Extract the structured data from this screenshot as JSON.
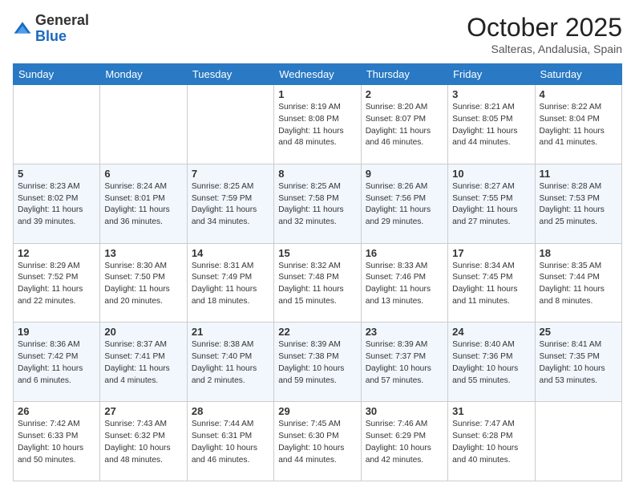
{
  "logo": {
    "general": "General",
    "blue": "Blue"
  },
  "header": {
    "month": "October 2025",
    "location": "Salteras, Andalusia, Spain"
  },
  "days_of_week": [
    "Sunday",
    "Monday",
    "Tuesday",
    "Wednesday",
    "Thursday",
    "Friday",
    "Saturday"
  ],
  "weeks": [
    [
      {
        "day": "",
        "info": ""
      },
      {
        "day": "",
        "info": ""
      },
      {
        "day": "",
        "info": ""
      },
      {
        "day": "1",
        "info": "Sunrise: 8:19 AM\nSunset: 8:08 PM\nDaylight: 11 hours and 48 minutes."
      },
      {
        "day": "2",
        "info": "Sunrise: 8:20 AM\nSunset: 8:07 PM\nDaylight: 11 hours and 46 minutes."
      },
      {
        "day": "3",
        "info": "Sunrise: 8:21 AM\nSunset: 8:05 PM\nDaylight: 11 hours and 44 minutes."
      },
      {
        "day": "4",
        "info": "Sunrise: 8:22 AM\nSunset: 8:04 PM\nDaylight: 11 hours and 41 minutes."
      }
    ],
    [
      {
        "day": "5",
        "info": "Sunrise: 8:23 AM\nSunset: 8:02 PM\nDaylight: 11 hours and 39 minutes."
      },
      {
        "day": "6",
        "info": "Sunrise: 8:24 AM\nSunset: 8:01 PM\nDaylight: 11 hours and 36 minutes."
      },
      {
        "day": "7",
        "info": "Sunrise: 8:25 AM\nSunset: 7:59 PM\nDaylight: 11 hours and 34 minutes."
      },
      {
        "day": "8",
        "info": "Sunrise: 8:25 AM\nSunset: 7:58 PM\nDaylight: 11 hours and 32 minutes."
      },
      {
        "day": "9",
        "info": "Sunrise: 8:26 AM\nSunset: 7:56 PM\nDaylight: 11 hours and 29 minutes."
      },
      {
        "day": "10",
        "info": "Sunrise: 8:27 AM\nSunset: 7:55 PM\nDaylight: 11 hours and 27 minutes."
      },
      {
        "day": "11",
        "info": "Sunrise: 8:28 AM\nSunset: 7:53 PM\nDaylight: 11 hours and 25 minutes."
      }
    ],
    [
      {
        "day": "12",
        "info": "Sunrise: 8:29 AM\nSunset: 7:52 PM\nDaylight: 11 hours and 22 minutes."
      },
      {
        "day": "13",
        "info": "Sunrise: 8:30 AM\nSunset: 7:50 PM\nDaylight: 11 hours and 20 minutes."
      },
      {
        "day": "14",
        "info": "Sunrise: 8:31 AM\nSunset: 7:49 PM\nDaylight: 11 hours and 18 minutes."
      },
      {
        "day": "15",
        "info": "Sunrise: 8:32 AM\nSunset: 7:48 PM\nDaylight: 11 hours and 15 minutes."
      },
      {
        "day": "16",
        "info": "Sunrise: 8:33 AM\nSunset: 7:46 PM\nDaylight: 11 hours and 13 minutes."
      },
      {
        "day": "17",
        "info": "Sunrise: 8:34 AM\nSunset: 7:45 PM\nDaylight: 11 hours and 11 minutes."
      },
      {
        "day": "18",
        "info": "Sunrise: 8:35 AM\nSunset: 7:44 PM\nDaylight: 11 hours and 8 minutes."
      }
    ],
    [
      {
        "day": "19",
        "info": "Sunrise: 8:36 AM\nSunset: 7:42 PM\nDaylight: 11 hours and 6 minutes."
      },
      {
        "day": "20",
        "info": "Sunrise: 8:37 AM\nSunset: 7:41 PM\nDaylight: 11 hours and 4 minutes."
      },
      {
        "day": "21",
        "info": "Sunrise: 8:38 AM\nSunset: 7:40 PM\nDaylight: 11 hours and 2 minutes."
      },
      {
        "day": "22",
        "info": "Sunrise: 8:39 AM\nSunset: 7:38 PM\nDaylight: 10 hours and 59 minutes."
      },
      {
        "day": "23",
        "info": "Sunrise: 8:39 AM\nSunset: 7:37 PM\nDaylight: 10 hours and 57 minutes."
      },
      {
        "day": "24",
        "info": "Sunrise: 8:40 AM\nSunset: 7:36 PM\nDaylight: 10 hours and 55 minutes."
      },
      {
        "day": "25",
        "info": "Sunrise: 8:41 AM\nSunset: 7:35 PM\nDaylight: 10 hours and 53 minutes."
      }
    ],
    [
      {
        "day": "26",
        "info": "Sunrise: 7:42 AM\nSunset: 6:33 PM\nDaylight: 10 hours and 50 minutes."
      },
      {
        "day": "27",
        "info": "Sunrise: 7:43 AM\nSunset: 6:32 PM\nDaylight: 10 hours and 48 minutes."
      },
      {
        "day": "28",
        "info": "Sunrise: 7:44 AM\nSunset: 6:31 PM\nDaylight: 10 hours and 46 minutes."
      },
      {
        "day": "29",
        "info": "Sunrise: 7:45 AM\nSunset: 6:30 PM\nDaylight: 10 hours and 44 minutes."
      },
      {
        "day": "30",
        "info": "Sunrise: 7:46 AM\nSunset: 6:29 PM\nDaylight: 10 hours and 42 minutes."
      },
      {
        "day": "31",
        "info": "Sunrise: 7:47 AM\nSunset: 6:28 PM\nDaylight: 10 hours and 40 minutes."
      },
      {
        "day": "",
        "info": ""
      }
    ]
  ]
}
